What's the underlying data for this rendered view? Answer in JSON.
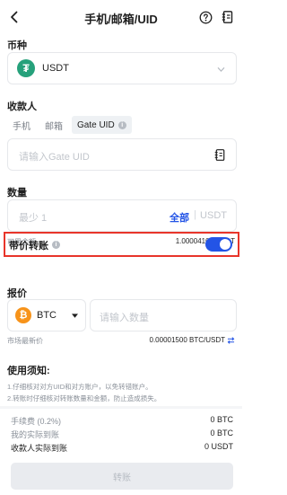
{
  "header": {
    "title": "手机/邮箱/UID"
  },
  "currency": {
    "section_label": "币种",
    "selected": "USDT"
  },
  "recipient": {
    "section_label": "收款人",
    "tabs": [
      {
        "label": "手机",
        "active": false
      },
      {
        "label": "邮箱",
        "active": false
      },
      {
        "label": "Gate UID",
        "active": true
      }
    ],
    "uid_placeholder": "请输入Gate UID"
  },
  "amount": {
    "section_label": "数量",
    "placeholder": "最少 1",
    "all_label": "全部",
    "unit": "USDT",
    "available_label": "可用余额",
    "available_value": "1.00004106 USDT"
  },
  "priced_transfer": {
    "label": "带价转账",
    "enabled": true
  },
  "quote": {
    "section_label": "报价",
    "coin": "BTC",
    "qty_placeholder": "请输入数量",
    "market_label": "市场最新价",
    "market_value": "0.00001500 BTC/USDT"
  },
  "notice": {
    "title": "使用须知:",
    "lines": [
      "1.仔细核对对方UID和对方账户，以免转错账户。",
      "2.转账时仔细核对转账数量和金额，防止造成损失。"
    ]
  },
  "fees": {
    "fee_label": "手续费 (0.2%)",
    "fee_value": "0 BTC",
    "my_actual_label": "我的实际到账",
    "my_actual_value": "0 BTC",
    "recipient_actual_label": "收款人实际到账",
    "recipient_actual_value": "0 USDT"
  },
  "submit_label": "转账",
  "colors": {
    "accent": "#2354e6",
    "highlight_border": "#e8352a",
    "usdt": "#26a17b",
    "btc": "#f7931a"
  }
}
